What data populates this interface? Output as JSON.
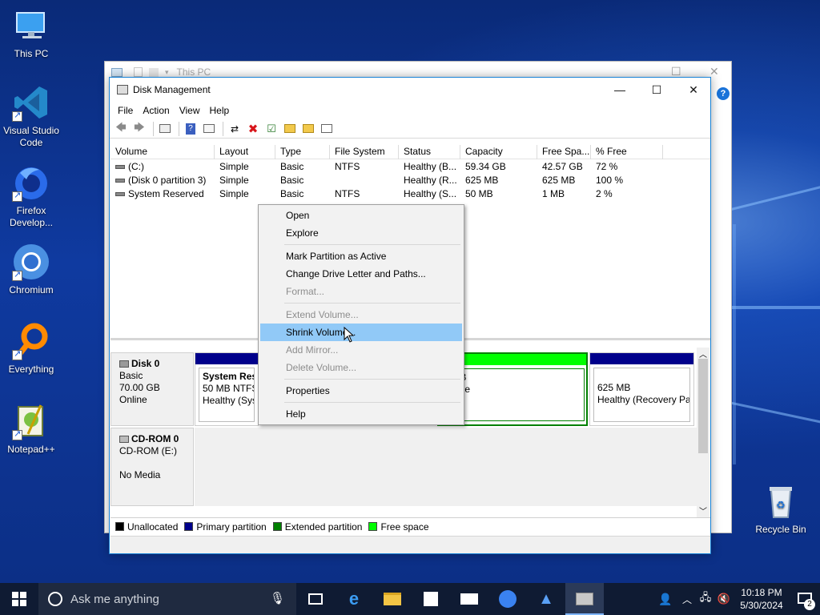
{
  "desktop": {
    "icons": [
      {
        "label": "This PC"
      },
      {
        "label": "Visual Studio Code"
      },
      {
        "label": "Firefox Develop..."
      },
      {
        "label": "Chromium"
      },
      {
        "label": "Everything"
      },
      {
        "label": "Notepad++"
      },
      {
        "label": "Recycle Bin"
      }
    ]
  },
  "back_window": {
    "title": "This PC"
  },
  "window": {
    "title": "Disk Management",
    "menus": [
      "File",
      "Action",
      "View",
      "Help"
    ],
    "minimize": "—",
    "maximize": "☐",
    "close": "✕"
  },
  "volume_list": {
    "columns": [
      "Volume",
      "Layout",
      "Type",
      "File System",
      "Status",
      "Capacity",
      "Free Spa...",
      "% Free"
    ],
    "rows": [
      [
        "(C:)",
        "Simple",
        "Basic",
        "NTFS",
        "Healthy (B...",
        "59.34 GB",
        "42.57 GB",
        "72 %"
      ],
      [
        "(Disk 0 partition 3)",
        "Simple",
        "Basic",
        "",
        "Healthy (R...",
        "625 MB",
        "625 MB",
        "100 %"
      ],
      [
        "System Reserved",
        "Simple",
        "Basic",
        "NTFS",
        "Healthy (S...",
        "50 MB",
        "1 MB",
        "2 %"
      ]
    ]
  },
  "disks": {
    "disk0": {
      "name": "Disk 0",
      "type": "Basic",
      "size": "70.00 GB",
      "state": "Online",
      "partitions": [
        {
          "name": "System Res",
          "size": "50 MB NTFS",
          "status": "Healthy (Sys"
        },
        {
          "size": "0 GB",
          "status": "space"
        },
        {
          "size": "625 MB",
          "status": "Healthy (Recovery Par"
        }
      ]
    },
    "cdrom0": {
      "name": "CD-ROM 0",
      "type": "CD-ROM (E:)",
      "media": "No Media"
    }
  },
  "legend": [
    {
      "label": "Unallocated",
      "color": "#000000"
    },
    {
      "label": "Primary partition",
      "color": "#00008b"
    },
    {
      "label": "Extended partition",
      "color": "#008000"
    },
    {
      "label": "Free space",
      "color": "#00ff00"
    }
  ],
  "context_menu": {
    "items": [
      {
        "label": "Open",
        "enabled": true
      },
      {
        "label": "Explore",
        "enabled": true
      },
      {
        "label": "Mark Partition as Active",
        "enabled": true
      },
      {
        "label": "Change Drive Letter and Paths...",
        "enabled": true
      },
      {
        "label": "Format...",
        "enabled": false
      },
      {
        "label": "Extend Volume...",
        "enabled": false
      },
      {
        "label": "Shrink Volume...",
        "enabled": true,
        "highlighted": true
      },
      {
        "label": "Add Mirror...",
        "enabled": false
      },
      {
        "label": "Delete Volume...",
        "enabled": false
      },
      {
        "label": "Properties",
        "enabled": true
      },
      {
        "label": "Help",
        "enabled": true
      }
    ]
  },
  "taskbar": {
    "search_placeholder": "Ask me anything",
    "time": "10:18 PM",
    "date": "5/30/2024",
    "notification_count": "2"
  },
  "colors": {
    "primary_partition": "#00008b",
    "free_space": "#00ff00",
    "highlight": "#91c9f7",
    "accent": "#1883d7"
  }
}
